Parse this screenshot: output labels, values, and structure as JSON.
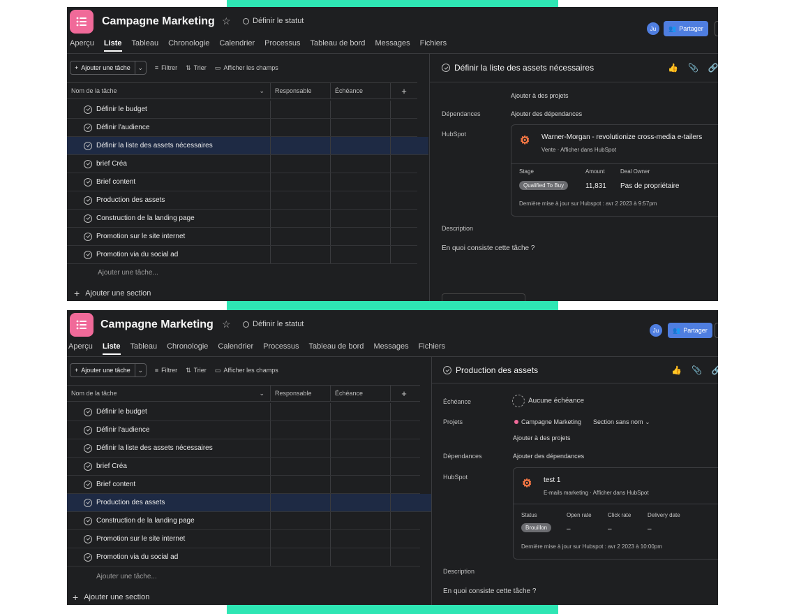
{
  "app": {
    "project_title": "Campagne Marketing",
    "status_label": "Définir le statut",
    "avatar_initials": "Ju",
    "share_label": "Partager",
    "accent_color": "#4f7ee0",
    "icon_color": "#f06a99"
  },
  "tabs": [
    "Aperçu",
    "Liste",
    "Tableau",
    "Chronologie",
    "Calendrier",
    "Processus",
    "Tableau de bord",
    "Messages",
    "Fichiers"
  ],
  "active_tab": "Liste",
  "toolbar": {
    "add_task": "Ajouter une tâche",
    "filter": "Filtrer",
    "sort": "Trier",
    "show_fields": "Afficher les champs"
  },
  "columns": {
    "name": "Nom de la tâche",
    "assignee": "Responsable",
    "due": "Échéance",
    "add": "+"
  },
  "tasks": [
    "Définir le budget",
    "Définir l'audience",
    "Définir la liste des assets nécessaires",
    "brief Créa",
    "Brief content",
    "Production des assets",
    "Construction de la landing page",
    "Promotion sur le site internet",
    "Promotion via du social ad"
  ],
  "add_task_inline": "Ajouter une tâche...",
  "add_section": "Ajouter une section",
  "panel1": {
    "selected_task": "Définir la liste des assets nécessaires",
    "add_to_projects": "Ajouter à des projets",
    "dependencies_label": "Dépendances",
    "dependencies_value": "Ajouter des dépendances",
    "hubspot_label": "HubSpot",
    "hubspot": {
      "title": "Warner-Morgan - revolutionize cross-media e-tailers",
      "subtitle": "Vente · Afficher dans HubSpot",
      "k1": "Stage",
      "k2": "Amount",
      "k3": "Deal Owner",
      "stage": "Qualified To Buy",
      "amount": "11,831",
      "owner": "Pas de propriétaire",
      "footer": "Dernière mise à jour sur Hubspot : avr 2 2023 à 9:57pm"
    },
    "description_label": "Description",
    "description_placeholder": "En quoi consiste cette tâche ?"
  },
  "panel2": {
    "selected_task": "Production des assets",
    "due_label": "Échéance",
    "due_value": "Aucune échéance",
    "projects_label": "Projets",
    "project_name": "Campagne Marketing",
    "section_name": "Section sans nom",
    "add_to_projects": "Ajouter à des projets",
    "dependencies_label": "Dépendances",
    "dependencies_value": "Ajouter des dépendances",
    "hubspot_label": "HubSpot",
    "hubspot": {
      "title": "test 1",
      "subtitle": "E-mails marketing · Afficher dans HubSpot",
      "k1": "Status",
      "k2": "Open rate",
      "k3": "Click rate",
      "k4": "Delivery date",
      "status": "Brouillon",
      "v2": "–",
      "v3": "–",
      "v4": "–",
      "footer": "Dernière mise à jour sur Hubspot : avr 2 2023 à 10:00pm"
    },
    "description_label": "Description",
    "description_placeholder": "En quoi consiste cette tâche ?"
  }
}
